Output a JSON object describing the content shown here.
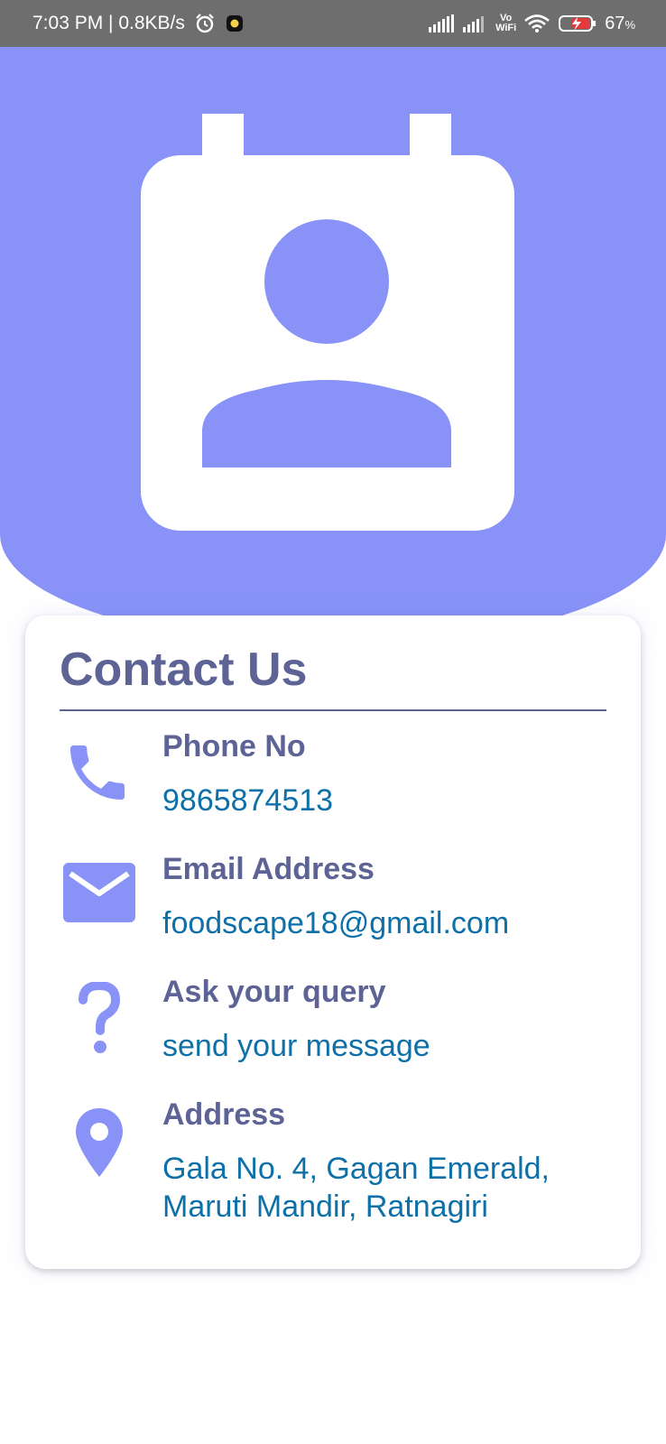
{
  "status_bar": {
    "time_speed": "7:03 PM | 0.8KB/s",
    "vowifi_top": "Vo",
    "vowifi_bottom": "WiFi",
    "battery": "67",
    "battery_unit": "%"
  },
  "colors": {
    "header": "#8892f7",
    "title": "#5d6394",
    "value": "#0e70a8"
  },
  "header": {
    "icon": "contact-card-icon"
  },
  "card": {
    "title": "Contact Us",
    "items": [
      {
        "icon": "phone-icon",
        "label": "Phone No",
        "value": "9865874513"
      },
      {
        "icon": "email-icon",
        "label": "Email Address",
        "value": "foodscape18@gmail.com"
      },
      {
        "icon": "question-icon",
        "label": "Ask your query",
        "value": "send your message"
      },
      {
        "icon": "location-pin-icon",
        "label": "Address",
        "value_line1": "Gala No. 4, Gagan Emerald,",
        "value_line2": "Maruti Mandir, Ratnagiri"
      }
    ]
  }
}
